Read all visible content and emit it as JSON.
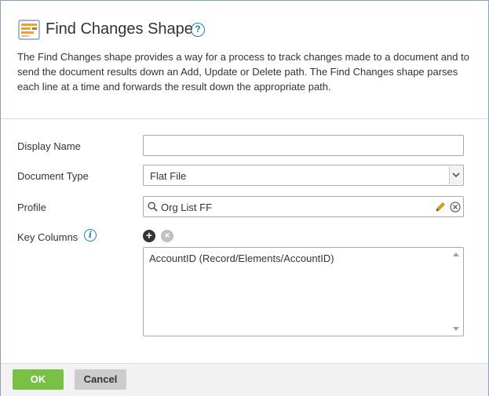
{
  "dialog": {
    "title": "Find Changes Shape",
    "help_glyph": "?",
    "description": "The Find Changes shape provides a way for a process to track changes made to a document and to send the document results down an Add, Update or Delete path. The Find Changes shape parses each line at a time and forwards the result down the appropriate path."
  },
  "form": {
    "display_name": {
      "label": "Display Name",
      "value": ""
    },
    "document_type": {
      "label": "Document Type",
      "value": "Flat File"
    },
    "profile": {
      "label": "Profile",
      "value": "Org List FF"
    },
    "key_columns": {
      "label": "Key Columns",
      "info_glyph": "i",
      "add_glyph": "+",
      "remove_glyph": "×",
      "items": [
        "AccountID (Record/Elements/AccountID)"
      ]
    }
  },
  "footer": {
    "ok_label": "OK",
    "cancel_label": "Cancel"
  },
  "colors": {
    "accent_blue": "#1a7fc8",
    "ok_green": "#78c145",
    "cancel_gray": "#cccccc",
    "dialog_border": "#8aa0b8"
  },
  "icons": {
    "title": "find-changes-shape-icon",
    "help": "help-icon",
    "search": "search-icon",
    "edit": "pencil-icon",
    "clear": "clear-icon",
    "info": "info-icon",
    "add": "add-icon",
    "remove": "remove-icon"
  }
}
